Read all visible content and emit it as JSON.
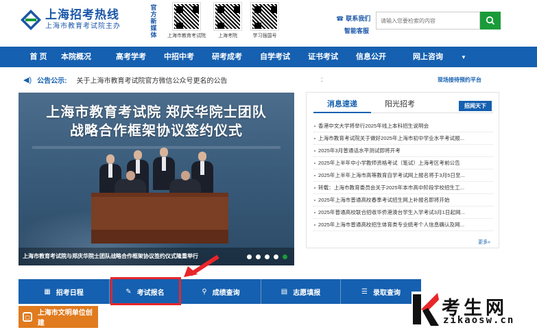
{
  "header": {
    "logo_title": "上海招考热线",
    "logo_sub": "上海市教育考试院主办",
    "media_label": "官方新媒体",
    "qr_codes": [
      {
        "label": "上海市教育考试院"
      },
      {
        "label": "上海考院"
      },
      {
        "label": "学习强国号"
      }
    ],
    "contact_us": "联系我们",
    "smart_service": "智能客服",
    "search_placeholder": "请输入您要检索的内容"
  },
  "nav": {
    "items": [
      "首 页",
      "本院概况",
      "高考学考",
      "中招中考",
      "研考成考",
      "自学考试",
      "证书考试",
      "信息公开",
      "网上咨询"
    ]
  },
  "notice": {
    "label": "公告公示:",
    "text": "关于上海市教育考试院官方微信公众号更名的公告",
    "right_link": "现场接待预约平台"
  },
  "banner": {
    "title_line1": "上海市教育考试院  郑庆华院士团队",
    "title_line2": "战略合作框架协议签约仪式",
    "caption": "上海市教育考试院与郑庆华院士团队战略合作框架协议签约仪式隆重举行",
    "slide_count": 5,
    "active_slide": 5
  },
  "news": {
    "tabs": [
      "消息速递",
      "阳光招考"
    ],
    "active_tab": 0,
    "button": "招闻天下",
    "items": [
      "香港中文大学将举行2025年线上本科招生说明会",
      "上海市教育考试院关于做好2025年上海市初中学业水平考试报...",
      "2025年3月普通话水平测试即将开考",
      "2025年上半年中小学教师资格考试（笔试）上海考区考前公告",
      "2025年上半年上海市高等教育自学考试网上报名将于3月5日至...",
      "转载：上海市教育委员会关于2025年本市高中阶段学校招生工...",
      "2025年上海市普通高校春季考试招生网上补报名即将开始",
      "2025年普通高校联合招收华侨港澳台学生入学考试3月1日起网...",
      "2025年上海市普通高校招生体育类专业统考个人信息确认及网..."
    ],
    "more": "更多»"
  },
  "quick_links": {
    "items": [
      {
        "label": "招考日程",
        "icon": "calendar-icon"
      },
      {
        "label": "考试报名",
        "icon": "pencil-icon"
      },
      {
        "label": "成绩查询",
        "icon": "search-icon"
      },
      {
        "label": "志愿填报",
        "icon": "form-icon"
      },
      {
        "label": "录取查询",
        "icon": "list-icon"
      }
    ],
    "highlighted_index": 1
  },
  "civil": {
    "label": "上海市文明单位创建"
  },
  "watermark": {
    "title": "考生网",
    "url": "zikaosw.cn"
  },
  "colors": {
    "primary": "#1560b0",
    "green": "#1a9b3a",
    "orange": "#e07b1f",
    "highlight": "#e8262a"
  }
}
